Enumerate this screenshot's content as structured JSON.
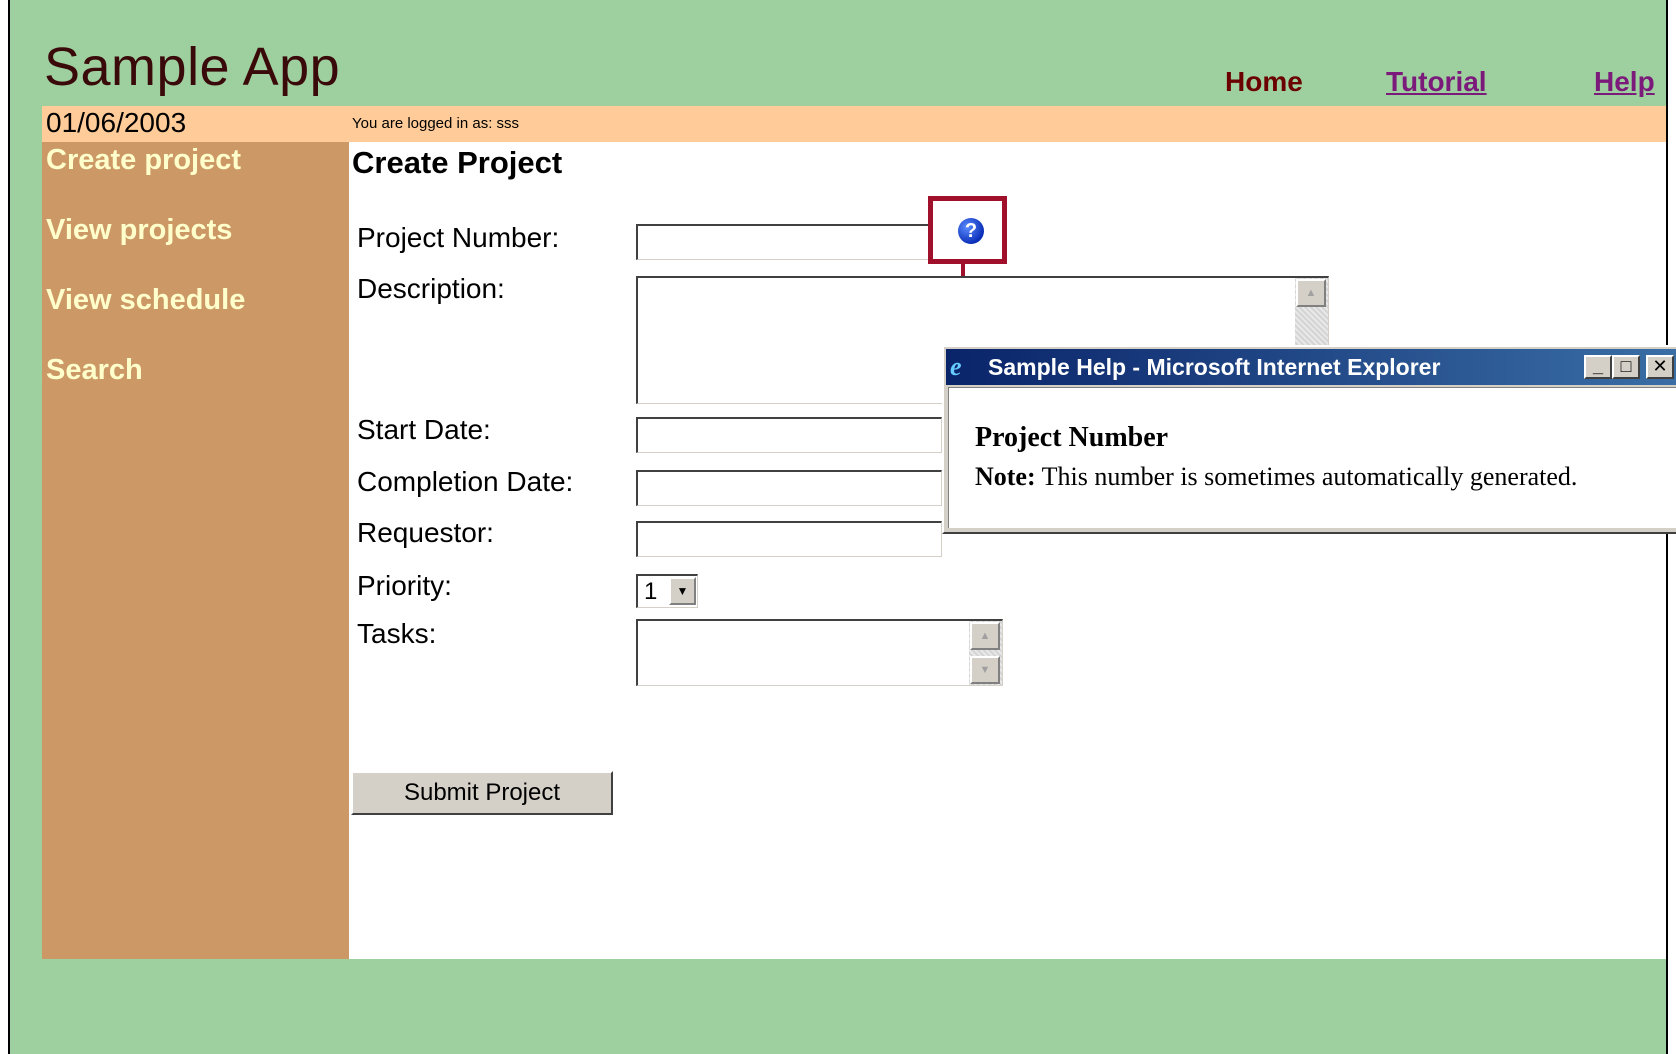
{
  "app": {
    "title": "Sample App"
  },
  "nav": {
    "home": "Home",
    "tutorial": "Tutorial",
    "help": "Help"
  },
  "info_bar": {
    "date": "01/06/2003",
    "login_text": "You are logged in as: sss"
  },
  "sidebar": {
    "items": [
      {
        "label": "Create project"
      },
      {
        "label": "View projects"
      },
      {
        "label": "View schedule"
      },
      {
        "label": "Search"
      }
    ]
  },
  "form": {
    "title": "Create Project",
    "labels": {
      "project_number": "Project Number:",
      "description": "Description:",
      "start_date": "Start Date:",
      "completion_date": "Completion Date:",
      "requestor": "Requestor:",
      "priority": "Priority:",
      "tasks": "Tasks:"
    },
    "values": {
      "project_number": "",
      "start_date": "",
      "completion_date": "",
      "requestor": "",
      "priority": "1"
    },
    "submit_label": "Submit Project",
    "help_icon": "question-mark-icon"
  },
  "popup": {
    "title": "Sample Help - Microsoft Internet Explorer",
    "heading": "Project Number",
    "note_label": "Note:",
    "note_text": "This number is sometimes automatically generated."
  },
  "colors": {
    "page_background": "#9ecf9e",
    "info_bar": "#ffcc99",
    "sidebar": "#cc9966",
    "sidebar_text": "#ffffcc",
    "highlight_box": "#a0102a",
    "title_bar": "#0a246a"
  }
}
